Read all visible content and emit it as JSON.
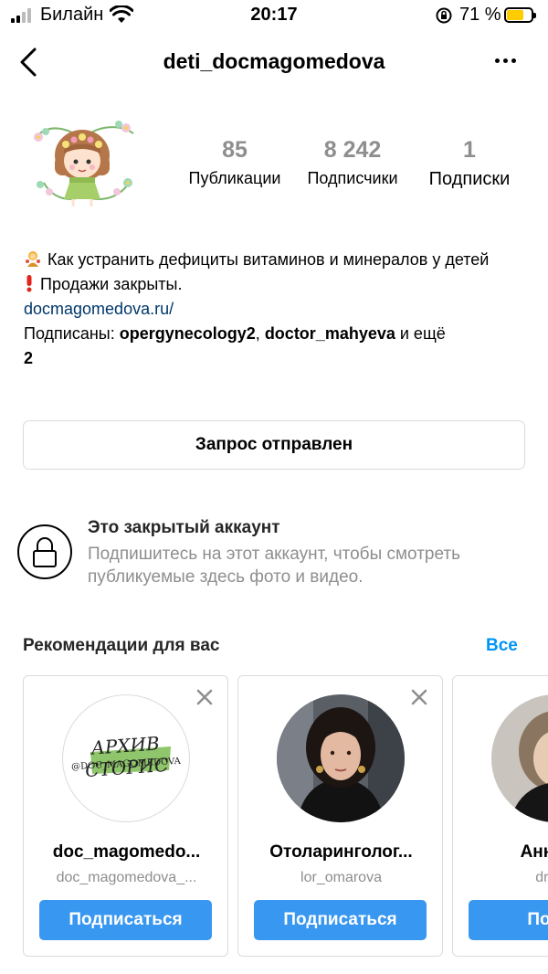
{
  "status_bar": {
    "carrier": "Билайн",
    "time": "20:17",
    "battery_percent": "71 %",
    "battery_level": 0.71,
    "battery_color": "#ffcc00"
  },
  "header": {
    "username": "deti_docmagomedova",
    "back_icon": "chevron-left-icon",
    "more_icon": "more-horizontal-icon"
  },
  "profile": {
    "stats": [
      {
        "value": "85",
        "label": "Публикации"
      },
      {
        "value": "8 242",
        "label": "Подписчики"
      },
      {
        "value": "1",
        "label": "Подписки"
      }
    ]
  },
  "bio": {
    "line1": "Как устранить дефициты витаминов и минералов у детей",
    "line2": "Продажи закрыты.",
    "link": "docmagomedova.ru/",
    "followed_by_prefix": "Подписаны: ",
    "followed_by_user1": "opergynecology2",
    "followed_by_sep": ", ",
    "followed_by_user2": "doctor_mahyeva",
    "followed_by_suffix": " и ещё",
    "followed_by_count": "2"
  },
  "request_button": {
    "label": "Запрос отправлен"
  },
  "private_notice": {
    "title": "Это закрытый аккаунт",
    "text": "Подпишитесь на этот аккаунт, чтобы смотреть публикуемые здесь фото и видео."
  },
  "recommendations": {
    "title": "Рекомендации для вас",
    "see_all": "Все",
    "cards": [
      {
        "name": "doc_magomedo...",
        "handle": "doc_magomedova_...",
        "button": "Подписаться",
        "logo_line1": "АРХИВ СТОРИС",
        "logo_line2": "@DOC_MAGOMEDOVA"
      },
      {
        "name": "Отоларинголог...",
        "handle": "lor_omarova",
        "button": "Подписаться"
      },
      {
        "name": "Анна Эд",
        "handle": "dr.pop",
        "button": "Подпи"
      }
    ]
  },
  "colors": {
    "accent": "#0095f6",
    "follow_button": "#3897f0",
    "link": "#00376b",
    "muted": "#8e8e8e"
  }
}
